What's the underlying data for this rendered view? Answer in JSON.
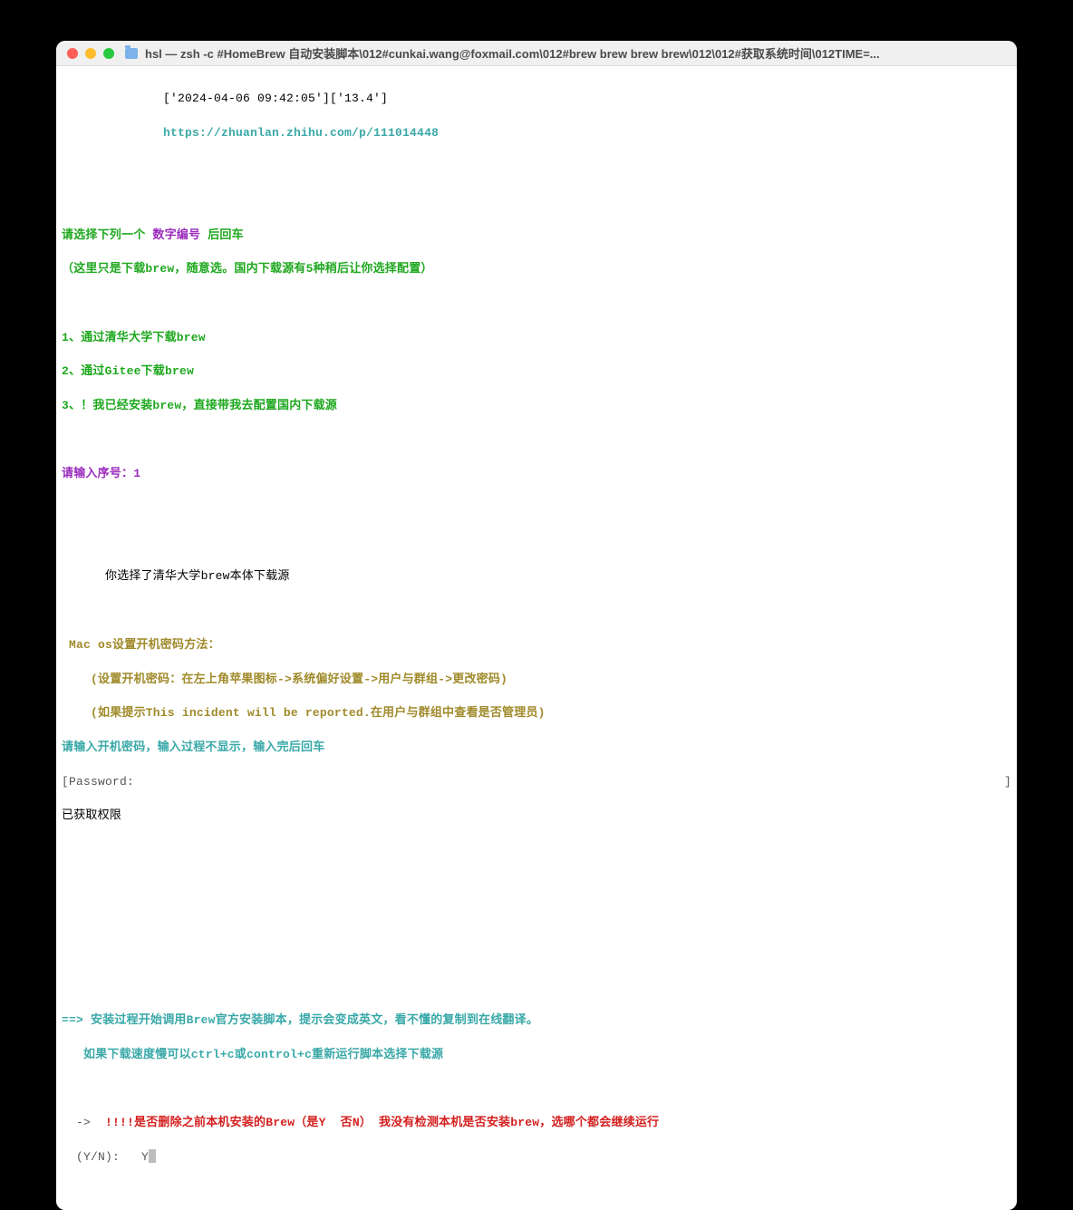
{
  "window": {
    "title": "hsl — zsh -c #HomeBrew 自动安装脚本\\012#cunkai.wang@foxmail.com\\012#brew brew brew brew\\012\\012#获取系统时间\\012TIME=..."
  },
  "lines": {
    "timestamp": "              ['2024-04-06 09:42:05']['13.4']",
    "url": "              https://zhuanlan.zhihu.com/p/111014448",
    "prompt_prefix": "请选择下列一个 ",
    "prompt_mid": "数字编号",
    "prompt_suffix": " 后回车",
    "prompt_note": "（这里只是下载brew，随意选。国内下载源有5种稍后让你选择配置）",
    "opt1": "1、通过清华大学下载brew",
    "opt2": "2、通过Gitee下载brew",
    "opt3": "3、！我已经安装brew，直接带我去配置国内下载源",
    "input_prompt": "请输入序号：",
    "input_value": "1",
    "choice_result": "      你选择了清华大学brew本体下载源",
    "mac_title": " Mac os设置开机密码方法：",
    "mac_line1": "    (设置开机密码：在左上角苹果图标->系统偏好设置->用户与群组->更改密码)",
    "mac_line2": "    (如果提示This incident will be reported.在用户与群组中查看是否管理员)",
    "pw_prompt": "请输入开机密码，输入过程不显示，输入完后回车",
    "pw_label_left": "[",
    "pw_label": "Password:",
    "pw_label_right": "]",
    "pw_got": "已获取权限",
    "install_arrow": "==> ",
    "install_msg": "安装过程开始调用Brew官方安装脚本，提示会变成英文，看不懂的复制到在线翻译。",
    "install_sub": "   如果下载速度慢可以ctrl+c或control+c重新运行脚本选择下载源",
    "del_arrow": "  -> ",
    "del_msg": " !!!!是否删除之前本机安装的Brew（是Y  否N） 我没有检测本机是否安装brew，选哪个都会继续运行",
    "yn_prompt": "  (Y/N): ",
    "yn_value": "  Y"
  }
}
